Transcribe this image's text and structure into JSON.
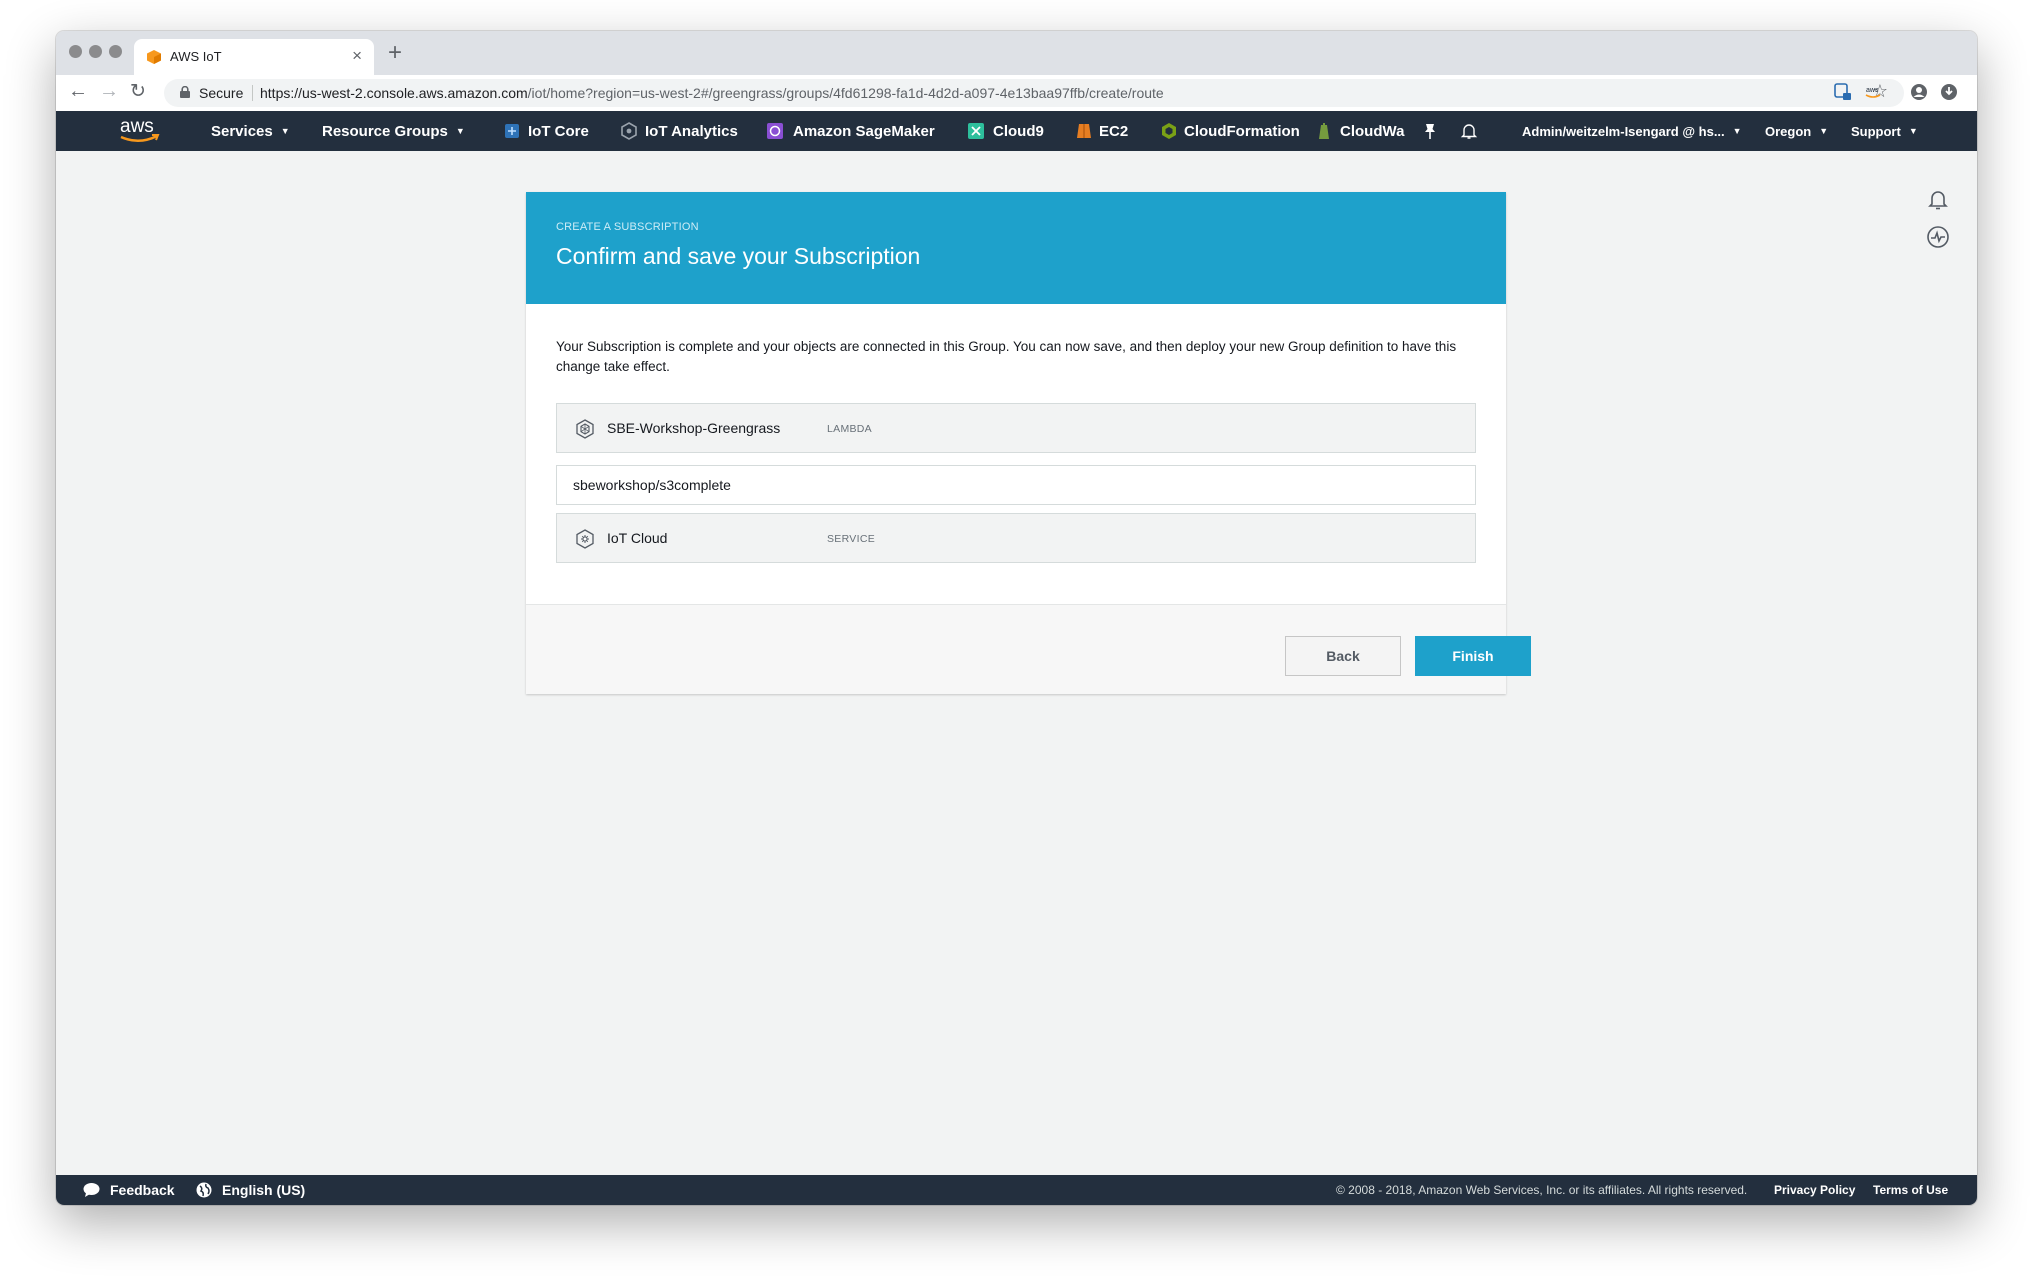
{
  "browser": {
    "tab_title": "AWS IoT",
    "secure_label": "Secure",
    "url_host": "https://us-west-2.console.aws.amazon.com",
    "url_path": "/iot/home?region=us-west-2#/greengrass/groups/4fd61298-fa1d-4d2d-a097-4e13baa97ffb/create/route"
  },
  "aws_nav": {
    "logo_text": "aws",
    "services": "Services",
    "resource_groups": "Resource Groups",
    "shortcuts": [
      {
        "label": "IoT Core",
        "icon": "iot-core-icon",
        "color": "#2e73b8"
      },
      {
        "label": "IoT Analytics",
        "icon": "iot-analytics-icon",
        "color": "#6c757d"
      },
      {
        "label": "Amazon SageMaker",
        "icon": "sagemaker-icon",
        "color": "#8a4fd3"
      },
      {
        "label": "Cloud9",
        "icon": "cloud9-icon",
        "color": "#2dbf9c"
      },
      {
        "label": "EC2",
        "icon": "ec2-icon",
        "color": "#e67e22"
      },
      {
        "label": "CloudFormation",
        "icon": "cloudformation-icon",
        "color": "#7aa116"
      },
      {
        "label": "CloudWa",
        "icon": "cloudwatch-icon",
        "color": "#759c3e"
      }
    ],
    "account": "Admin/weitzelm-Isengard @ hs...",
    "region": "Oregon",
    "support": "Support"
  },
  "card": {
    "eyebrow": "CREATE A SUBSCRIPTION",
    "title": "Confirm and save your Subscription",
    "description": "Your Subscription is complete and your objects are connected in this Group. You can now save, and then deploy your new Group definition to have this change take effect.",
    "source": {
      "name": "SBE-Workshop-Greengrass",
      "type": "LAMBDA"
    },
    "topic": "sbeworkshop/s3complete",
    "target": {
      "name": "IoT Cloud",
      "type": "SERVICE"
    },
    "back_label": "Back",
    "finish_label": "Finish"
  },
  "footer": {
    "feedback": "Feedback",
    "language": "English (US)",
    "copyright": "© 2008 - 2018, Amazon Web Services, Inc. or its affiliates. All rights reserved.",
    "privacy": "Privacy Policy",
    "terms": "Terms of Use"
  },
  "colors": {
    "accent": "#1ea1cb",
    "nav_bg": "#232f3e",
    "page_bg": "#f2f3f3"
  }
}
